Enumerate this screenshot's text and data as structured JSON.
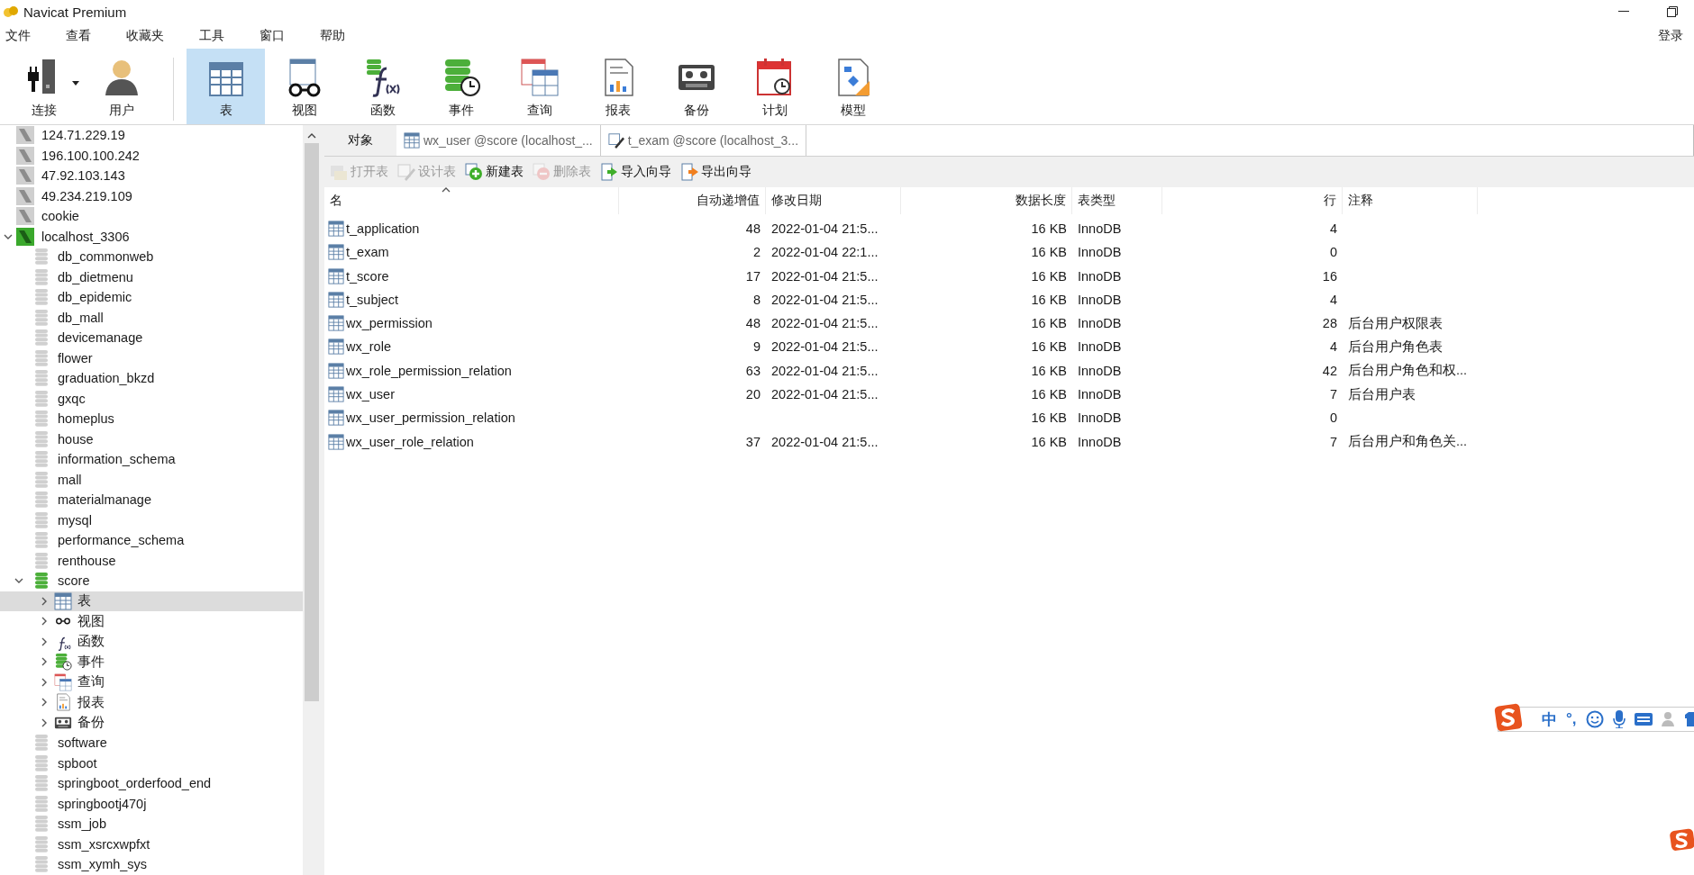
{
  "window": {
    "title": "Navicat Premium"
  },
  "menu": [
    "文件",
    "查看",
    "收藏夹",
    "工具",
    "窗口",
    "帮助"
  ],
  "login": "登录",
  "toolbar": [
    {
      "kind": "connection",
      "label": "连接",
      "dropdown": true,
      "selected": false
    },
    {
      "kind": "user",
      "label": "用户",
      "selected": false
    },
    {
      "kind": "table",
      "label": "表",
      "selected": true
    },
    {
      "kind": "view",
      "label": "视图",
      "selected": false
    },
    {
      "kind": "function",
      "label": "函数",
      "selected": false
    },
    {
      "kind": "event",
      "label": "事件",
      "selected": false
    },
    {
      "kind": "query",
      "label": "查询",
      "selected": false
    },
    {
      "kind": "report",
      "label": "报表",
      "selected": false
    },
    {
      "kind": "backup",
      "label": "备份",
      "selected": false
    },
    {
      "kind": "schedule",
      "label": "计划",
      "selected": false
    },
    {
      "kind": "model",
      "label": "模型",
      "selected": false
    }
  ],
  "sidebar": {
    "items": [
      {
        "kind": "server",
        "label": "124.71.229.19",
        "connected": false
      },
      {
        "kind": "server",
        "label": "196.100.100.242",
        "connected": false
      },
      {
        "kind": "server",
        "label": "47.92.103.143",
        "connected": false
      },
      {
        "kind": "server",
        "label": "49.234.219.109",
        "connected": false
      },
      {
        "kind": "server",
        "label": "cookie",
        "connected": false
      },
      {
        "kind": "server",
        "label": "localhost_3306",
        "connected": true,
        "expanded": true,
        "children": [
          {
            "kind": "database",
            "label": "db_commonweb",
            "open": false
          },
          {
            "kind": "database",
            "label": "db_dietmenu",
            "open": false
          },
          {
            "kind": "database",
            "label": "db_epidemic",
            "open": false
          },
          {
            "kind": "database",
            "label": "db_mall",
            "open": false
          },
          {
            "kind": "database",
            "label": "devicemanage",
            "open": false
          },
          {
            "kind": "database",
            "label": "flower",
            "open": false
          },
          {
            "kind": "database",
            "label": "graduation_bkzd",
            "open": false
          },
          {
            "kind": "database",
            "label": "gxqc",
            "open": false
          },
          {
            "kind": "database",
            "label": "homeplus",
            "open": false
          },
          {
            "kind": "database",
            "label": "house",
            "open": false
          },
          {
            "kind": "database",
            "label": "information_schema",
            "open": false
          },
          {
            "kind": "database",
            "label": "mall",
            "open": false
          },
          {
            "kind": "database",
            "label": "materialmanage",
            "open": false
          },
          {
            "kind": "database",
            "label": "mysql",
            "open": false
          },
          {
            "kind": "database",
            "label": "performance_schema",
            "open": false
          },
          {
            "kind": "database",
            "label": "renthouse",
            "open": false
          },
          {
            "kind": "database",
            "label": "score",
            "open": true,
            "expanded": true,
            "children": [
              {
                "kind": "table",
                "label": "表",
                "selected": true,
                "expanded": false
              },
              {
                "kind": "view",
                "label": "视图",
                "selected": false,
                "expanded": false
              },
              {
                "kind": "function",
                "label": "函数",
                "selected": false,
                "expanded": false
              },
              {
                "kind": "event",
                "label": "事件",
                "selected": false,
                "expanded": false
              },
              {
                "kind": "query",
                "label": "查询",
                "selected": false,
                "expanded": false
              },
              {
                "kind": "report",
                "label": "报表",
                "selected": false,
                "expanded": false
              },
              {
                "kind": "backup",
                "label": "备份",
                "selected": false,
                "expanded": false
              }
            ]
          },
          {
            "kind": "database",
            "label": "software",
            "open": false
          },
          {
            "kind": "database",
            "label": "spboot",
            "open": false
          },
          {
            "kind": "database",
            "label": "springboot_orderfood_end",
            "open": false
          },
          {
            "kind": "database",
            "label": "springbootj470j",
            "open": false
          },
          {
            "kind": "database",
            "label": "ssm_job",
            "open": false
          },
          {
            "kind": "database",
            "label": "ssm_xsrcxwpfxt",
            "open": false
          },
          {
            "kind": "database",
            "label": "ssm_xymh_sys",
            "open": false
          }
        ]
      }
    ]
  },
  "tabs": [
    {
      "kind": "objects",
      "label": "对象",
      "selected": true
    },
    {
      "kind": "table",
      "label": "wx_user @score (localhost_...",
      "selected": false
    },
    {
      "kind": "design",
      "label": "t_exam @score (localhost_3...",
      "selected": false
    }
  ],
  "object_toolbar": [
    {
      "kind": "open",
      "label": "打开表",
      "disabled": true
    },
    {
      "kind": "design",
      "label": "设计表",
      "disabled": true
    },
    {
      "kind": "new",
      "label": "新建表",
      "disabled": false
    },
    {
      "kind": "delete",
      "label": "删除表",
      "disabled": true
    },
    {
      "kind": "import",
      "label": "导入向导",
      "disabled": false
    },
    {
      "kind": "export",
      "label": "导出向导",
      "disabled": false
    }
  ],
  "table": {
    "columns": [
      {
        "label": "名",
        "kind": "text",
        "sorted": true
      },
      {
        "label": "自动递增值",
        "kind": "number"
      },
      {
        "label": "修改日期",
        "kind": "text"
      },
      {
        "label": "数据长度",
        "kind": "number"
      },
      {
        "label": "表类型",
        "kind": "text"
      },
      {
        "label": "行",
        "kind": "number"
      },
      {
        "label": "注释",
        "kind": "text"
      }
    ],
    "rows": [
      [
        "t_application",
        "48",
        "2022-01-04 21:5...",
        "16 KB",
        "InnoDB",
        "4",
        ""
      ],
      [
        "t_exam",
        "2",
        "2022-01-04 22:1...",
        "16 KB",
        "InnoDB",
        "0",
        ""
      ],
      [
        "t_score",
        "17",
        "2022-01-04 21:5...",
        "16 KB",
        "InnoDB",
        "16",
        ""
      ],
      [
        "t_subject",
        "8",
        "2022-01-04 21:5...",
        "16 KB",
        "InnoDB",
        "4",
        ""
      ],
      [
        "wx_permission",
        "48",
        "2022-01-04 21:5...",
        "16 KB",
        "InnoDB",
        "28",
        "后台用户权限表"
      ],
      [
        "wx_role",
        "9",
        "2022-01-04 21:5...",
        "16 KB",
        "InnoDB",
        "4",
        "后台用户角色表"
      ],
      [
        "wx_role_permission_relation",
        "63",
        "2022-01-04 21:5...",
        "16 KB",
        "InnoDB",
        "42",
        "后台用户角色和权..."
      ],
      [
        "wx_user",
        "20",
        "2022-01-04 21:5...",
        "16 KB",
        "InnoDB",
        "7",
        "后台用户表"
      ],
      [
        "wx_user_permission_relation",
        "",
        "",
        "16 KB",
        "InnoDB",
        "0",
        ""
      ],
      [
        "wx_user_role_relation",
        "37",
        "2022-01-04 21:5...",
        "16 KB",
        "InnoDB",
        "7",
        "后台用户和角色关..."
      ]
    ]
  },
  "ime_bar": {
    "mode": "中",
    "punctuation": "°,"
  }
}
